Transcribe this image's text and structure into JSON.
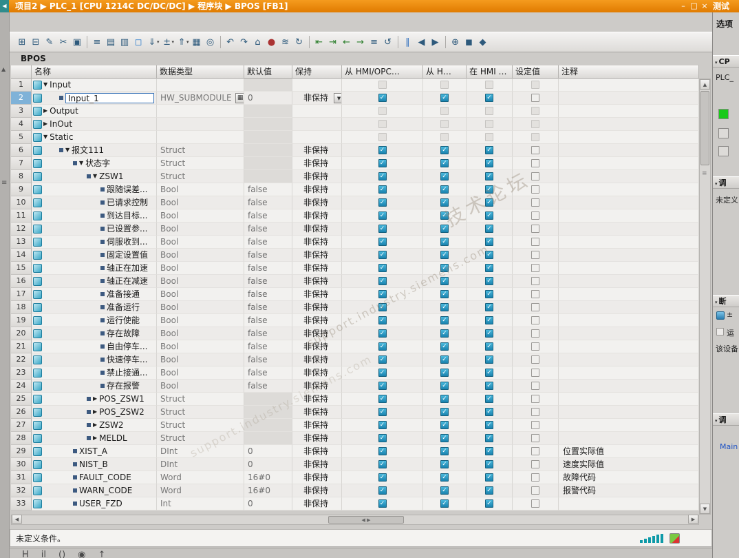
{
  "titlebar": {
    "breadcrumb": "项目2  ▶  PLC_1 [CPU 1214C DC/DC/DC]  ▶  程序块  ▶  BPOS [FB1]",
    "window": {
      "minimize": "–",
      "restore": "□",
      "close": "×"
    },
    "right_tab": "测试"
  },
  "toolbar": {
    "items": [
      {
        "name": "insert-row",
        "glyph": "⊞"
      },
      {
        "name": "delete-row",
        "glyph": "⊟"
      },
      {
        "name": "rename",
        "glyph": "✎"
      },
      {
        "name": "cut",
        "glyph": "✂"
      },
      {
        "name": "copy",
        "glyph": "▣"
      },
      {
        "sep": true
      },
      {
        "name": "network-list",
        "glyph": "≡"
      },
      {
        "name": "lad-view",
        "glyph": "▤"
      },
      {
        "name": "fbd-view",
        "glyph": "▥"
      },
      {
        "name": "comment-toggle",
        "glyph": "◻",
        "color": "#2277cc"
      },
      {
        "name": "download-start-values",
        "glyph": "⇓",
        "drop": true
      },
      {
        "name": "modify-values",
        "glyph": "±",
        "drop": true
      },
      {
        "name": "upload-values",
        "glyph": "⇑",
        "drop": true
      },
      {
        "name": "expand-all",
        "glyph": "▦"
      },
      {
        "name": "find",
        "glyph": "◎"
      },
      {
        "sep": true
      },
      {
        "name": "undo",
        "glyph": "↶"
      },
      {
        "name": "redo",
        "glyph": "↷"
      },
      {
        "name": "go-home",
        "glyph": "⌂"
      },
      {
        "name": "breakpoint",
        "glyph": "●",
        "color": "#aa3333"
      },
      {
        "name": "monitor-all",
        "glyph": "≋"
      },
      {
        "name": "refresh",
        "glyph": "↻"
      },
      {
        "sep": true
      },
      {
        "name": "step-backward",
        "glyph": "⇤",
        "color": "#2a7d2a"
      },
      {
        "name": "step-forward",
        "glyph": "⇥",
        "color": "#2a7d2a"
      },
      {
        "name": "jump-to-prev",
        "glyph": "←",
        "color": "#2a7d2a"
      },
      {
        "name": "jump-to-next",
        "glyph": "→",
        "color": "#2a7d2a"
      },
      {
        "name": "call-structure",
        "glyph": "≡"
      },
      {
        "name": "sync",
        "glyph": "↺"
      },
      {
        "sep": true
      },
      {
        "name": "pause",
        "glyph": "∥",
        "color": "#2266bb"
      },
      {
        "name": "prev-difference",
        "glyph": "◀"
      },
      {
        "name": "next-difference",
        "glyph": "▶"
      },
      {
        "sep": true
      },
      {
        "name": "search-tools",
        "glyph": "⊕"
      },
      {
        "name": "snapshot",
        "glyph": "◼"
      },
      {
        "name": "library",
        "glyph": "◆"
      }
    ],
    "right_icon": {
      "name": "window-layout",
      "glyph": "⊡"
    }
  },
  "block": {
    "title": "BPOS"
  },
  "glyphs": {
    "check": "✓",
    "arrow_down": "▼",
    "arrow_right": "▶",
    "dropdown": "▼",
    "browse": "▦",
    "collapse_left": "◀",
    "chevron": "▾",
    "scroll_up": "▲",
    "scroll_down": "▼",
    "scroll_left": "◀",
    "scroll_right": "▶",
    "splitter": "≡",
    "hthumb_marks": "◀ ▶",
    "left_strip_up": "▲",
    "left_strip_handle": "≡"
  },
  "table": {
    "columns": [
      "名称",
      "数据类型",
      "默认值",
      "保持",
      "从 HMI/OPC…",
      "从 H…",
      "在 HMI …",
      "设定值",
      "注释"
    ],
    "rows": [
      {
        "num": 1,
        "name": "Input",
        "ind": 0,
        "arr": "down",
        "bul": false,
        "dt": "",
        "def": "",
        "ret": "",
        "cb": [
          "disabled",
          "disabled",
          "disabled",
          "disabled"
        ],
        "cmt": "",
        "sh": true
      },
      {
        "num": 2,
        "name": "Input_1",
        "ind": 1,
        "arr": null,
        "bul": true,
        "dt": "HW_SUBMODULE",
        "def": "0",
        "ret": "非保持",
        "cb": [
          "checked",
          "checked",
          "checked",
          "unchecked"
        ],
        "cmt": "",
        "ed": true,
        "br": true,
        "dd": true,
        "sel": true
      },
      {
        "num": 3,
        "name": "Output",
        "ind": 0,
        "arr": "right",
        "bul": false,
        "dt": "",
        "def": "",
        "ret": "",
        "cb": [
          "disabled",
          "disabled",
          "disabled",
          "disabled"
        ],
        "cmt": "",
        "sh": true
      },
      {
        "num": 4,
        "name": "InOut",
        "ind": 0,
        "arr": "right",
        "bul": false,
        "dt": "",
        "def": "",
        "ret": "",
        "cb": [
          "disabled",
          "disabled",
          "disabled",
          "disabled"
        ],
        "cmt": "",
        "sh": true
      },
      {
        "num": 5,
        "name": "Static",
        "ind": 0,
        "arr": "down",
        "bul": false,
        "dt": "",
        "def": "",
        "ret": "",
        "cb": [
          "disabled",
          "disabled",
          "disabled",
          "disabled"
        ],
        "cmt": "",
        "sh": true
      },
      {
        "num": 6,
        "name": "报文111",
        "ind": 1,
        "arr": "down",
        "bul": true,
        "dt": "Struct",
        "def": "",
        "ret": "非保持",
        "cb": [
          "checked",
          "checked",
          "checked",
          "unchecked"
        ],
        "cmt": "",
        "sh": true
      },
      {
        "num": 7,
        "name": "状态字",
        "ind": 2,
        "arr": "down",
        "bul": true,
        "dt": "Struct",
        "def": "",
        "ret": "非保持",
        "cb": [
          "checked",
          "checked",
          "checked",
          "unchecked"
        ],
        "cmt": "",
        "sh": true
      },
      {
        "num": 8,
        "name": "ZSW1",
        "ind": 3,
        "arr": "down",
        "bul": true,
        "dt": "Struct",
        "def": "",
        "ret": "非保持",
        "cb": [
          "checked",
          "checked",
          "checked",
          "unchecked"
        ],
        "cmt": "",
        "sh": true
      },
      {
        "num": 9,
        "name": "跟随误差...",
        "ind": 4,
        "arr": null,
        "bul": true,
        "dt": "Bool",
        "def": "false",
        "ret": "非保持",
        "cb": [
          "checked",
          "checked",
          "checked",
          "unchecked"
        ],
        "cmt": ""
      },
      {
        "num": 10,
        "name": "已请求控制",
        "ind": 4,
        "arr": null,
        "bul": true,
        "dt": "Bool",
        "def": "false",
        "ret": "非保持",
        "cb": [
          "checked",
          "checked",
          "checked",
          "unchecked"
        ],
        "cmt": ""
      },
      {
        "num": 11,
        "name": "到达目标...",
        "ind": 4,
        "arr": null,
        "bul": true,
        "dt": "Bool",
        "def": "false",
        "ret": "非保持",
        "cb": [
          "checked",
          "checked",
          "checked",
          "unchecked"
        ],
        "cmt": ""
      },
      {
        "num": 12,
        "name": "已设置参...",
        "ind": 4,
        "arr": null,
        "bul": true,
        "dt": "Bool",
        "def": "false",
        "ret": "非保持",
        "cb": [
          "checked",
          "checked",
          "checked",
          "unchecked"
        ],
        "cmt": ""
      },
      {
        "num": 13,
        "name": "伺服收到...",
        "ind": 4,
        "arr": null,
        "bul": true,
        "dt": "Bool",
        "def": "false",
        "ret": "非保持",
        "cb": [
          "checked",
          "checked",
          "checked",
          "unchecked"
        ],
        "cmt": ""
      },
      {
        "num": 14,
        "name": "固定设置值",
        "ind": 4,
        "arr": null,
        "bul": true,
        "dt": "Bool",
        "def": "false",
        "ret": "非保持",
        "cb": [
          "checked",
          "checked",
          "checked",
          "unchecked"
        ],
        "cmt": ""
      },
      {
        "num": 15,
        "name": "轴正在加速",
        "ind": 4,
        "arr": null,
        "bul": true,
        "dt": "Bool",
        "def": "false",
        "ret": "非保持",
        "cb": [
          "checked",
          "checked",
          "checked",
          "unchecked"
        ],
        "cmt": ""
      },
      {
        "num": 16,
        "name": "轴正在减速",
        "ind": 4,
        "arr": null,
        "bul": true,
        "dt": "Bool",
        "def": "false",
        "ret": "非保持",
        "cb": [
          "checked",
          "checked",
          "checked",
          "unchecked"
        ],
        "cmt": ""
      },
      {
        "num": 17,
        "name": "准备接通",
        "ind": 4,
        "arr": null,
        "bul": true,
        "dt": "Bool",
        "def": "false",
        "ret": "非保持",
        "cb": [
          "checked",
          "checked",
          "checked",
          "unchecked"
        ],
        "cmt": ""
      },
      {
        "num": 18,
        "name": "准备运行",
        "ind": 4,
        "arr": null,
        "bul": true,
        "dt": "Bool",
        "def": "false",
        "ret": "非保持",
        "cb": [
          "checked",
          "checked",
          "checked",
          "unchecked"
        ],
        "cmt": ""
      },
      {
        "num": 19,
        "name": "运行使能",
        "ind": 4,
        "arr": null,
        "bul": true,
        "dt": "Bool",
        "def": "false",
        "ret": "非保持",
        "cb": [
          "checked",
          "checked",
          "checked",
          "unchecked"
        ],
        "cmt": ""
      },
      {
        "num": 20,
        "name": "存在故障",
        "ind": 4,
        "arr": null,
        "bul": true,
        "dt": "Bool",
        "def": "false",
        "ret": "非保持",
        "cb": [
          "checked",
          "checked",
          "checked",
          "unchecked"
        ],
        "cmt": ""
      },
      {
        "num": 21,
        "name": "自由停车...",
        "ind": 4,
        "arr": null,
        "bul": true,
        "dt": "Bool",
        "def": "false",
        "ret": "非保持",
        "cb": [
          "checked",
          "checked",
          "checked",
          "unchecked"
        ],
        "cmt": ""
      },
      {
        "num": 22,
        "name": "快速停车...",
        "ind": 4,
        "arr": null,
        "bul": true,
        "dt": "Bool",
        "def": "false",
        "ret": "非保持",
        "cb": [
          "checked",
          "checked",
          "checked",
          "unchecked"
        ],
        "cmt": ""
      },
      {
        "num": 23,
        "name": "禁止接通...",
        "ind": 4,
        "arr": null,
        "bul": true,
        "dt": "Bool",
        "def": "false",
        "ret": "非保持",
        "cb": [
          "checked",
          "checked",
          "checked",
          "unchecked"
        ],
        "cmt": ""
      },
      {
        "num": 24,
        "name": "存在报警",
        "ind": 4,
        "arr": null,
        "bul": true,
        "dt": "Bool",
        "def": "false",
        "ret": "非保持",
        "cb": [
          "checked",
          "checked",
          "checked",
          "unchecked"
        ],
        "cmt": ""
      },
      {
        "num": 25,
        "name": "POS_ZSW1",
        "ind": 3,
        "arr": "right",
        "bul": true,
        "dt": "Struct",
        "def": "",
        "ret": "非保持",
        "cb": [
          "checked",
          "checked",
          "checked",
          "unchecked"
        ],
        "cmt": "",
        "sh": true
      },
      {
        "num": 26,
        "name": "POS_ZSW2",
        "ind": 3,
        "arr": "right",
        "bul": true,
        "dt": "Struct",
        "def": "",
        "ret": "非保持",
        "cb": [
          "checked",
          "checked",
          "checked",
          "unchecked"
        ],
        "cmt": "",
        "sh": true
      },
      {
        "num": 27,
        "name": "ZSW2",
        "ind": 3,
        "arr": "right",
        "bul": true,
        "dt": "Struct",
        "def": "",
        "ret": "非保持",
        "cb": [
          "checked",
          "checked",
          "checked",
          "unchecked"
        ],
        "cmt": "",
        "sh": true
      },
      {
        "num": 28,
        "name": "MELDL",
        "ind": 3,
        "arr": "right",
        "bul": true,
        "dt": "Struct",
        "def": "",
        "ret": "非保持",
        "cb": [
          "checked",
          "checked",
          "checked",
          "unchecked"
        ],
        "cmt": "",
        "sh": true
      },
      {
        "num": 29,
        "name": "XIST_A",
        "ind": 2,
        "arr": null,
        "bul": true,
        "dt": "DInt",
        "def": "0",
        "ret": "非保持",
        "cb": [
          "checked",
          "checked",
          "checked",
          "unchecked"
        ],
        "cmt": "位置实际值"
      },
      {
        "num": 30,
        "name": "NIST_B",
        "ind": 2,
        "arr": null,
        "bul": true,
        "dt": "DInt",
        "def": "0",
        "ret": "非保持",
        "cb": [
          "checked",
          "checked",
          "checked",
          "unchecked"
        ],
        "cmt": "速度实际值"
      },
      {
        "num": 31,
        "name": "FAULT_CODE",
        "ind": 2,
        "arr": null,
        "bul": true,
        "dt": "Word",
        "def": "16#0",
        "ret": "非保持",
        "cb": [
          "checked",
          "checked",
          "checked",
          "unchecked"
        ],
        "cmt": "故障代码"
      },
      {
        "num": 32,
        "name": "WARN_CODE",
        "ind": 2,
        "arr": null,
        "bul": true,
        "dt": "Word",
        "def": "16#0",
        "ret": "非保持",
        "cb": [
          "checked",
          "checked",
          "checked",
          "unchecked"
        ],
        "cmt": "报警代码"
      },
      {
        "num": 33,
        "name": "USER_FZD",
        "ind": 2,
        "arr": null,
        "bul": true,
        "dt": "Int",
        "def": "0",
        "ret": "非保持",
        "cb": [
          "checked",
          "checked",
          "checked",
          "unchecked"
        ],
        "cmt": ""
      }
    ]
  },
  "right_panel": {
    "tab": "测试",
    "options": "选项",
    "section_cpu": "CP",
    "cpu_label": "PLC_",
    "section_call1": "调",
    "undefined_text": "未定义",
    "section_break": "断",
    "bp_plusminus": "±",
    "run_text": "运",
    "device_text": "该设备",
    "section_call2": "调",
    "main_link": "Main"
  },
  "statusbar": {
    "text": "未定义条件。"
  },
  "bottombar": {
    "icons": [
      "H",
      "il",
      "()",
      "◉",
      "↑"
    ]
  },
  "watermark": {
    "forum": "技术论坛",
    "site": "support.industry.siemens.com"
  },
  "colors": {
    "accent_orange": "#e07b00",
    "check_blue": "#1a82ae",
    "online_green": "#19c919",
    "link_blue": "#1f53c5",
    "watermark": "#968a78"
  }
}
